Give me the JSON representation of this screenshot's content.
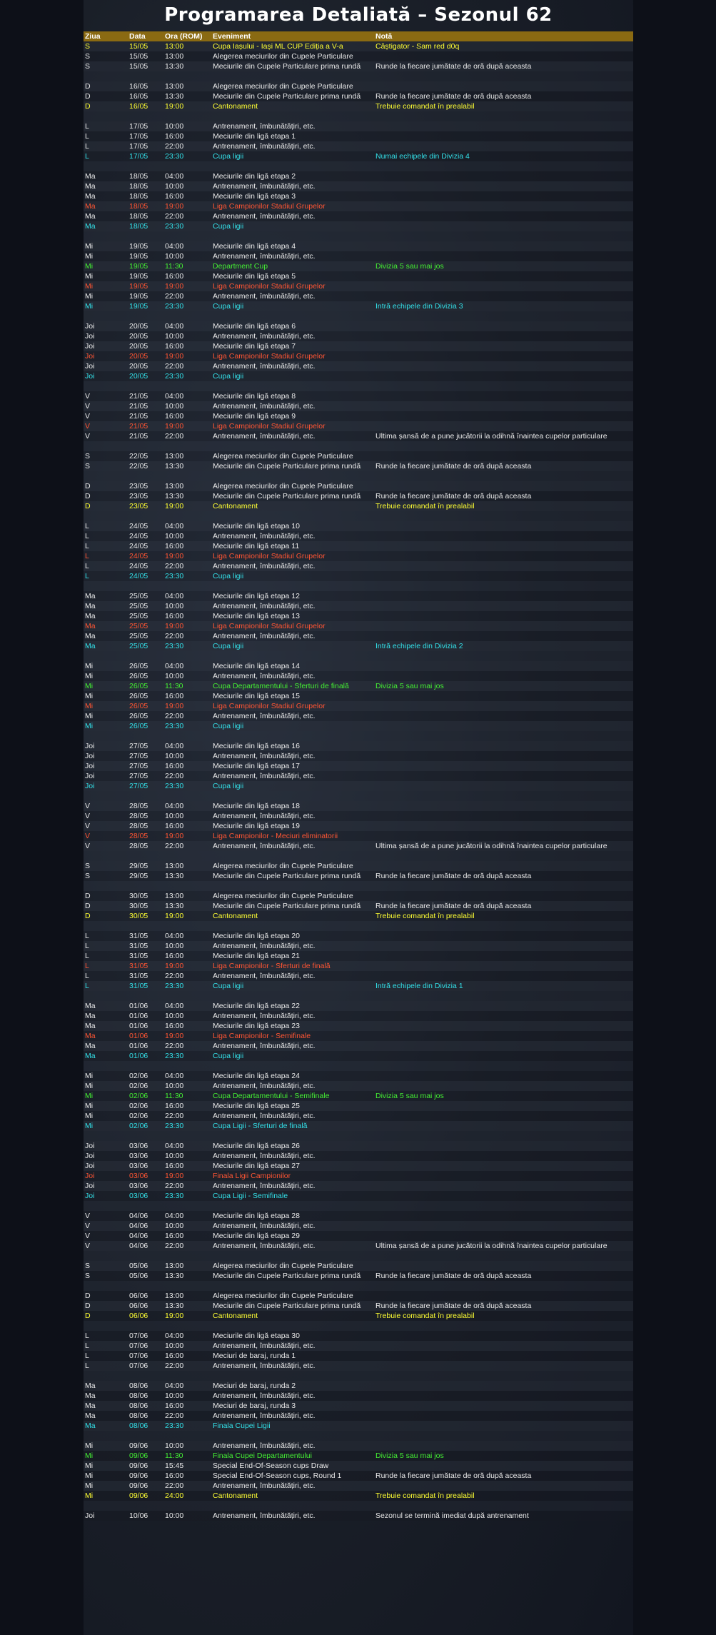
{
  "page": {
    "title": "Programarea Detaliată – Sezonul 62"
  },
  "colors": {
    "header_bg": "#8a6a12",
    "white": "#e8e8e8",
    "yellow": "#ffff33",
    "cyan": "#33e0e8",
    "red": "#ff5533",
    "green": "#44ee33"
  },
  "table": {
    "headers": [
      "Ziua",
      "Data",
      "Ora (ROM)",
      "Eveniment",
      "Notă"
    ],
    "rows": [
      [
        "S",
        "15/05",
        "13:00",
        "Cupa Iașului - Iași ML CUP Ediția a V-a",
        "Câștigator - Sam red d0q",
        "yellow"
      ],
      [
        "S",
        "15/05",
        "13:00",
        "Alegerea meciurilor din Cupele Particulare",
        "",
        "white"
      ],
      [
        "S",
        "15/05",
        "13:30",
        "Meciurile din Cupele Particulare prima rundă",
        "Runde la fiecare jumătate de oră după aceasta",
        "white"
      ],
      null,
      [
        "D",
        "16/05",
        "13:00",
        "Alegerea meciurilor din Cupele Particulare",
        "",
        "white"
      ],
      [
        "D",
        "16/05",
        "13:30",
        "Meciurile din Cupele Particulare prima rundă",
        "Runde la fiecare jumătate de oră după aceasta",
        "white"
      ],
      [
        "D",
        "16/05",
        "19:00",
        "Cantonament",
        "Trebuie comandat în prealabil",
        "yellow"
      ],
      null,
      [
        "L",
        "17/05",
        "10:00",
        "Antrenament, îmbunătățiri, etc.",
        "",
        "white"
      ],
      [
        "L",
        "17/05",
        "16:00",
        "Meciurile din ligă etapa 1",
        "",
        "white"
      ],
      [
        "L",
        "17/05",
        "22:00",
        "Antrenament, îmbunătățiri, etc.",
        "",
        "white"
      ],
      [
        "L",
        "17/05",
        "23:30",
        "Cupa ligii",
        "Numai echipele din Divizia 4",
        "cyan"
      ],
      null,
      [
        "Ma",
        "18/05",
        "04:00",
        "Meciurile din ligă etapa 2",
        "",
        "white"
      ],
      [
        "Ma",
        "18/05",
        "10:00",
        "Antrenament, îmbunătățiri, etc.",
        "",
        "white"
      ],
      [
        "Ma",
        "18/05",
        "16:00",
        "Meciurile din ligă etapa 3",
        "",
        "white"
      ],
      [
        "Ma",
        "18/05",
        "19:00",
        "Liga Campionilor Stadiul Grupelor",
        "",
        "red"
      ],
      [
        "Ma",
        "18/05",
        "22:00",
        "Antrenament, îmbunătățiri, etc.",
        "",
        "white"
      ],
      [
        "Ma",
        "18/05",
        "23:30",
        "Cupa ligii",
        "",
        "cyan"
      ],
      null,
      [
        "Mi",
        "19/05",
        "04:00",
        "Meciurile din ligă etapa 4",
        "",
        "white"
      ],
      [
        "Mi",
        "19/05",
        "10:00",
        "Antrenament, îmbunătățiri, etc.",
        "",
        "white"
      ],
      [
        "Mi",
        "19/05",
        "11:30",
        "Department Cup",
        "Divizia 5 sau mai jos",
        "green"
      ],
      [
        "Mi",
        "19/05",
        "16:00",
        "Meciurile din ligă etapa 5",
        "",
        "white"
      ],
      [
        "Mi",
        "19/05",
        "19:00",
        "Liga Campionilor Stadiul Grupelor",
        "",
        "red"
      ],
      [
        "Mi",
        "19/05",
        "22:00",
        "Antrenament, îmbunătățiri, etc.",
        "",
        "white"
      ],
      [
        "Mi",
        "19/05",
        "23:30",
        "Cupa ligii",
        "Intră echipele din Divizia 3",
        "cyan"
      ],
      null,
      [
        "Joi",
        "20/05",
        "04:00",
        "Meciurile din ligă etapa 6",
        "",
        "white"
      ],
      [
        "Joi",
        "20/05",
        "10:00",
        "Antrenament, îmbunătățiri, etc.",
        "",
        "white"
      ],
      [
        "Joi",
        "20/05",
        "16:00",
        "Meciurile din ligă etapa 7",
        "",
        "white"
      ],
      [
        "Joi",
        "20/05",
        "19:00",
        "Liga Campionilor Stadiul Grupelor",
        "",
        "red"
      ],
      [
        "Joi",
        "20/05",
        "22:00",
        "Antrenament, îmbunătățiri, etc.",
        "",
        "white"
      ],
      [
        "Joi",
        "20/05",
        "23:30",
        "Cupa ligii",
        "",
        "cyan"
      ],
      null,
      [
        "V",
        "21/05",
        "04:00",
        "Meciurile din ligă etapa 8",
        "",
        "white"
      ],
      [
        "V",
        "21/05",
        "10:00",
        "Antrenament, îmbunătățiri, etc.",
        "",
        "white"
      ],
      [
        "V",
        "21/05",
        "16:00",
        "Meciurile din ligă etapa 9",
        "",
        "white"
      ],
      [
        "V",
        "21/05",
        "19:00",
        "Liga Campionilor Stadiul Grupelor",
        "",
        "red"
      ],
      [
        "V",
        "21/05",
        "22:00",
        "Antrenament, îmbunătățiri, etc.",
        "Ultima șansă de a pune jucătorii la odihnă înaintea cupelor particulare",
        "white"
      ],
      null,
      [
        "S",
        "22/05",
        "13:00",
        "Alegerea meciurilor din Cupele Particulare",
        "",
        "white"
      ],
      [
        "S",
        "22/05",
        "13:30",
        "Meciurile din Cupele Particulare prima rundă",
        "Runde la fiecare jumătate de oră după aceasta",
        "white"
      ],
      null,
      [
        "D",
        "23/05",
        "13:00",
        "Alegerea meciurilor din Cupele Particulare",
        "",
        "white"
      ],
      [
        "D",
        "23/05",
        "13:30",
        "Meciurile din Cupele Particulare prima rundă",
        "Runde la fiecare jumătate de oră după aceasta",
        "white"
      ],
      [
        "D",
        "23/05",
        "19:00",
        "Cantonament",
        "Trebuie comandat în prealabil",
        "yellow"
      ],
      null,
      [
        "L",
        "24/05",
        "04:00",
        "Meciurile din ligă etapa 10",
        "",
        "white"
      ],
      [
        "L",
        "24/05",
        "10:00",
        "Antrenament, îmbunătățiri, etc.",
        "",
        "white"
      ],
      [
        "L",
        "24/05",
        "16:00",
        "Meciurile din ligă etapa 11",
        "",
        "white"
      ],
      [
        "L",
        "24/05",
        "19:00",
        "Liga Campionilor Stadiul Grupelor",
        "",
        "red"
      ],
      [
        "L",
        "24/05",
        "22:00",
        "Antrenament, îmbunătățiri, etc.",
        "",
        "white"
      ],
      [
        "L",
        "24/05",
        "23:30",
        "Cupa ligii",
        "",
        "cyan"
      ],
      null,
      [
        "Ma",
        "25/05",
        "04:00",
        "Meciurile din ligă etapa 12",
        "",
        "white"
      ],
      [
        "Ma",
        "25/05",
        "10:00",
        "Antrenament, îmbunătățiri, etc.",
        "",
        "white"
      ],
      [
        "Ma",
        "25/05",
        "16:00",
        "Meciurile din ligă etapa 13",
        "",
        "white"
      ],
      [
        "Ma",
        "25/05",
        "19:00",
        "Liga Campionilor Stadiul Grupelor",
        "",
        "red"
      ],
      [
        "Ma",
        "25/05",
        "22:00",
        "Antrenament, îmbunătățiri, etc.",
        "",
        "white"
      ],
      [
        "Ma",
        "25/05",
        "23:30",
        "Cupa ligii",
        "Intră echipele din Divizia 2",
        "cyan"
      ],
      null,
      [
        "Mi",
        "26/05",
        "04:00",
        "Meciurile din ligă etapa 14",
        "",
        "white"
      ],
      [
        "Mi",
        "26/05",
        "10:00",
        "Antrenament, îmbunătățiri, etc.",
        "",
        "white"
      ],
      [
        "Mi",
        "26/05",
        "11:30",
        "Cupa Departamentului - Sferturi de finală",
        "Divizia 5 sau mai jos",
        "green"
      ],
      [
        "Mi",
        "26/05",
        "16:00",
        "Meciurile din ligă etapa 15",
        "",
        "white"
      ],
      [
        "Mi",
        "26/05",
        "19:00",
        "Liga Campionilor Stadiul Grupelor",
        "",
        "red"
      ],
      [
        "Mi",
        "26/05",
        "22:00",
        "Antrenament, îmbunătățiri, etc.",
        "",
        "white"
      ],
      [
        "Mi",
        "26/05",
        "23:30",
        "Cupa ligii",
        "",
        "cyan"
      ],
      null,
      [
        "Joi",
        "27/05",
        "04:00",
        "Meciurile din ligă etapa 16",
        "",
        "white"
      ],
      [
        "Joi",
        "27/05",
        "10:00",
        "Antrenament, îmbunătățiri, etc.",
        "",
        "white"
      ],
      [
        "Joi",
        "27/05",
        "16:00",
        "Meciurile din ligă etapa 17",
        "",
        "white"
      ],
      [
        "Joi",
        "27/05",
        "22:00",
        "Antrenament, îmbunătățiri, etc.",
        "",
        "white"
      ],
      [
        "Joi",
        "27/05",
        "23:30",
        "Cupa ligii",
        "",
        "cyan"
      ],
      null,
      [
        "V",
        "28/05",
        "04:00",
        "Meciurile din ligă etapa 18",
        "",
        "white"
      ],
      [
        "V",
        "28/05",
        "10:00",
        "Antrenament, îmbunătățiri, etc.",
        "",
        "white"
      ],
      [
        "V",
        "28/05",
        "16:00",
        "Meciurile din ligă etapa 19",
        "",
        "white"
      ],
      [
        "V",
        "28/05",
        "19:00",
        "Liga Campionilor - Meciuri eliminatorii",
        "",
        "red"
      ],
      [
        "V",
        "28/05",
        "22:00",
        "Antrenament, îmbunătățiri, etc.",
        "Ultima șansă de a pune jucătorii la odihnă înaintea cupelor particulare",
        "white"
      ],
      null,
      [
        "S",
        "29/05",
        "13:00",
        "Alegerea meciurilor din Cupele Particulare",
        "",
        "white"
      ],
      [
        "S",
        "29/05",
        "13:30",
        "Meciurile din Cupele Particulare prima rundă",
        "Runde la fiecare jumătate de oră după aceasta",
        "white"
      ],
      null,
      [
        "D",
        "30/05",
        "13:00",
        "Alegerea meciurilor din Cupele Particulare",
        "",
        "white"
      ],
      [
        "D",
        "30/05",
        "13:30",
        "Meciurile din Cupele Particulare prima rundă",
        "Runde la fiecare jumătate de oră după aceasta",
        "white"
      ],
      [
        "D",
        "30/05",
        "19:00",
        "Cantonament",
        "Trebuie comandat în prealabil",
        "yellow"
      ],
      null,
      [
        "L",
        "31/05",
        "04:00",
        "Meciurile din ligă etapa 20",
        "",
        "white"
      ],
      [
        "L",
        "31/05",
        "10:00",
        "Antrenament, îmbunătățiri, etc.",
        "",
        "white"
      ],
      [
        "L",
        "31/05",
        "16:00",
        "Meciurile din ligă etapa 21",
        "",
        "white"
      ],
      [
        "L",
        "31/05",
        "19:00",
        "Liga Campionilor - Sferturi de finală",
        "",
        "red"
      ],
      [
        "L",
        "31/05",
        "22:00",
        "Antrenament, îmbunătățiri, etc.",
        "",
        "white"
      ],
      [
        "L",
        "31/05",
        "23:30",
        "Cupa ligii",
        "Intră echipele din Divizia 1",
        "cyan"
      ],
      null,
      [
        "Ma",
        "01/06",
        "04:00",
        "Meciurile din ligă etapa 22",
        "",
        "white"
      ],
      [
        "Ma",
        "01/06",
        "10:00",
        "Antrenament, îmbunătățiri, etc.",
        "",
        "white"
      ],
      [
        "Ma",
        "01/06",
        "16:00",
        "Meciurile din ligă etapa 23",
        "",
        "white"
      ],
      [
        "Ma",
        "01/06",
        "19:00",
        "Liga Campionilor - Semifinale",
        "",
        "red"
      ],
      [
        "Ma",
        "01/06",
        "22:00",
        "Antrenament, îmbunătățiri, etc.",
        "",
        "white"
      ],
      [
        "Ma",
        "01/06",
        "23:30",
        "Cupa ligii",
        "",
        "cyan"
      ],
      null,
      [
        "Mi",
        "02/06",
        "04:00",
        "Meciurile din ligă etapa 24",
        "",
        "white"
      ],
      [
        "Mi",
        "02/06",
        "10:00",
        "Antrenament, îmbunătățiri, etc.",
        "",
        "white"
      ],
      [
        "Mi",
        "02/06",
        "11:30",
        "Cupa Departamentului - Semifinale",
        "Divizia 5 sau mai jos",
        "green"
      ],
      [
        "Mi",
        "02/06",
        "16:00",
        "Meciurile din ligă etapa 25",
        "",
        "white"
      ],
      [
        "Mi",
        "02/06",
        "22:00",
        "Antrenament, îmbunătățiri, etc.",
        "",
        "white"
      ],
      [
        "Mi",
        "02/06",
        "23:30",
        "Cupa Ligii - Sferturi de finală",
        "",
        "cyan"
      ],
      null,
      [
        "Joi",
        "03/06",
        "04:00",
        "Meciurile din ligă etapa 26",
        "",
        "white"
      ],
      [
        "Joi",
        "03/06",
        "10:00",
        "Antrenament, îmbunătățiri, etc.",
        "",
        "white"
      ],
      [
        "Joi",
        "03/06",
        "16:00",
        "Meciurile din ligă etapa 27",
        "",
        "white"
      ],
      [
        "Joi",
        "03/06",
        "19:00",
        "Finala Ligii Campionilor",
        "",
        "red"
      ],
      [
        "Joi",
        "03/06",
        "22:00",
        "Antrenament, îmbunătățiri, etc.",
        "",
        "white"
      ],
      [
        "Joi",
        "03/06",
        "23:30",
        "Cupa Ligii - Semifinale",
        "",
        "cyan"
      ],
      null,
      [
        "V",
        "04/06",
        "04:00",
        "Meciurile din ligă etapa 28",
        "",
        "white"
      ],
      [
        "V",
        "04/06",
        "10:00",
        "Antrenament, îmbunătățiri, etc.",
        "",
        "white"
      ],
      [
        "V",
        "04/06",
        "16:00",
        "Meciurile din ligă etapa 29",
        "",
        "white"
      ],
      [
        "V",
        "04/06",
        "22:00",
        "Antrenament, îmbunătățiri, etc.",
        "Ultima șansă de a pune jucătorii la odihnă înaintea cupelor particulare",
        "white"
      ],
      null,
      [
        "S",
        "05/06",
        "13:00",
        "Alegerea meciurilor din Cupele Particulare",
        "",
        "white"
      ],
      [
        "S",
        "05/06",
        "13:30",
        "Meciurile din Cupele Particulare prima rundă",
        "Runde la fiecare jumătate de oră după aceasta",
        "white"
      ],
      null,
      [
        "D",
        "06/06",
        "13:00",
        "Alegerea meciurilor din Cupele Particulare",
        "",
        "white"
      ],
      [
        "D",
        "06/06",
        "13:30",
        "Meciurile din Cupele Particulare prima rundă",
        "Runde la fiecare jumătate de oră după aceasta",
        "white"
      ],
      [
        "D",
        "06/06",
        "19:00",
        "Cantonament",
        "Trebuie comandat în prealabil",
        "yellow"
      ],
      null,
      [
        "L",
        "07/06",
        "04:00",
        "Meciurile din ligă etapa 30",
        "",
        "white"
      ],
      [
        "L",
        "07/06",
        "10:00",
        "Antrenament, îmbunătățiri, etc.",
        "",
        "white"
      ],
      [
        "L",
        "07/06",
        "16:00",
        "Meciuri de baraj, runda 1",
        "",
        "white"
      ],
      [
        "L",
        "07/06",
        "22:00",
        "Antrenament, îmbunătățiri, etc.",
        "",
        "white"
      ],
      null,
      [
        "Ma",
        "08/06",
        "04:00",
        "Meciuri de baraj, runda 2",
        "",
        "white"
      ],
      [
        "Ma",
        "08/06",
        "10:00",
        "Antrenament, îmbunătățiri, etc.",
        "",
        "white"
      ],
      [
        "Ma",
        "08/06",
        "16:00",
        "Meciuri de baraj, runda 3",
        "",
        "white"
      ],
      [
        "Ma",
        "08/06",
        "22:00",
        "Antrenament, îmbunătățiri, etc.",
        "",
        "white"
      ],
      [
        "Ma",
        "08/06",
        "23:30",
        "Finala Cupei Ligii",
        "",
        "cyan"
      ],
      null,
      [
        "Mi",
        "09/06",
        "10:00",
        "Antrenament, îmbunătățiri, etc.",
        "",
        "white"
      ],
      [
        "Mi",
        "09/06",
        "11:30",
        "Finala Cupei Departamentului",
        "Divizia 5 sau mai jos",
        "green"
      ],
      [
        "Mi",
        "09/06",
        "15:45",
        "Special End-Of-Season cups Draw",
        "",
        "white"
      ],
      [
        "Mi",
        "09/06",
        "16:00",
        "Special End-Of-Season cups, Round 1",
        "Runde la fiecare jumătate de oră după aceasta",
        "white"
      ],
      [
        "Mi",
        "09/06",
        "22:00",
        "Antrenament, îmbunătățiri, etc.",
        "",
        "white"
      ],
      [
        "Mi",
        "09/06",
        "24:00",
        "Cantonament",
        "Trebuie comandat în prealabil",
        "yellow"
      ],
      null,
      [
        "Joi",
        "10/06",
        "10:00",
        "Antrenament, îmbunătățiri, etc.",
        "Sezonul se termină imediat după antrenament",
        "white"
      ]
    ]
  }
}
